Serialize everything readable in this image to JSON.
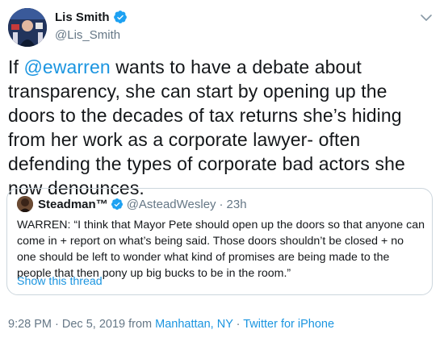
{
  "author": {
    "display_name": "Lis Smith",
    "handle": "@Lis_Smith",
    "avatar_icon": "profile-photo",
    "verified_icon": "verified-badge-icon"
  },
  "tweet": {
    "text_prefix": "If ",
    "mention": "@ewarren",
    "text_rest": " wants to have a debate about transparency, she can start by opening up the doors to the decades of tax returns she’s hiding from her work as a corporate lawyer- often defending the types of corporate bad actors she now denounces."
  },
  "quoted_tweet": {
    "display_name": "Steadman™",
    "handle": "@AsteadWesley",
    "separator": "·",
    "time": "23h",
    "text": "WARREN: “I think that Mayor Pete should open up the doors so that anyone can come in + report on what’s being said. Those doors shouldn’t be closed + no one should be left to wonder what kind of promises are being made to the people that then pony up big bucks to be in the room.”",
    "show_thread": "Show this thread"
  },
  "meta": {
    "timestamp": "9:28 PM · Dec 5, 2019 from ",
    "location": "Manhattan, NY",
    "separator": " · ",
    "source": "Twitter for iPhone"
  },
  "colors": {
    "link": "#1b95e0",
    "secondary_text": "#657786",
    "border": "#ccd6dd"
  }
}
